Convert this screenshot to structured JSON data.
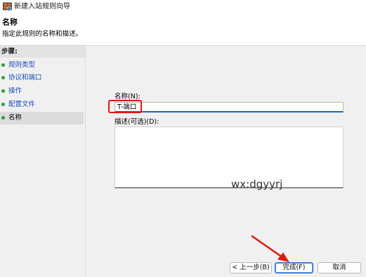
{
  "window": {
    "title": "新建入站规则向导",
    "icon": "firewall-shield-icon"
  },
  "header": {
    "title": "名称",
    "description": "指定此规则的名称和描述。"
  },
  "sidebar": {
    "heading": "步骤:",
    "items": [
      {
        "label": "规则类型",
        "state": "link"
      },
      {
        "label": "协议和端口",
        "state": "link"
      },
      {
        "label": "操作",
        "state": "link"
      },
      {
        "label": "配置文件",
        "state": "link"
      },
      {
        "label": "名称",
        "state": "current"
      }
    ]
  },
  "form": {
    "name_label": "名称(N):",
    "name_value": "T-端口",
    "description_label": "描述(可选)(D):",
    "description_value": ""
  },
  "overlay": {
    "watermark": "wx:dgyyrj",
    "highlight_color": "#e0190f"
  },
  "buttons": {
    "back": "< 上一步(B)",
    "finish": "完成(F)",
    "cancel": "取消"
  }
}
